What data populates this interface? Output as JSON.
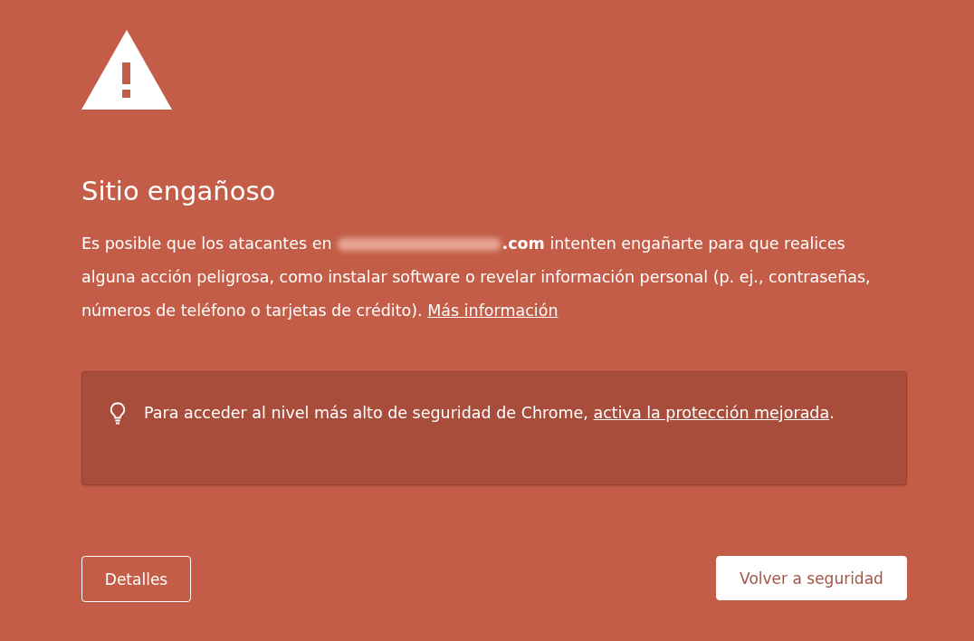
{
  "title": "Sitio engañoso",
  "message": {
    "before": "Es posible que los atacantes en",
    "domain": ".com",
    "after": "intenten engañarte para que realices alguna acción peligrosa, como instalar software o revelar información personal (p. ej., contraseñas, números de teléfono o tarjetas de crédito).",
    "link": "Más información"
  },
  "tip": {
    "text": "Para acceder al nivel más alto de seguridad de Chrome,",
    "link": "activa la protección mejorada",
    "end": "."
  },
  "buttons": [
    {
      "label": "Detalles",
      "kind": "outline"
    },
    {
      "label": "Volver a seguridad",
      "kind": "primary"
    }
  ]
}
